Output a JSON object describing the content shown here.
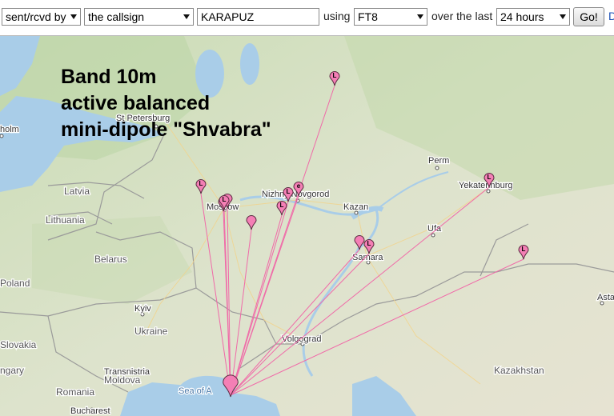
{
  "toolbar": {
    "direction_select": "sent/rcvd by",
    "target_select": "the callsign",
    "callsign_value": "KARAPUZ",
    "using_label": "using",
    "mode_select": "FT8",
    "over_label": "over the last",
    "period_select": "24 hours",
    "go_button": "Go!",
    "edge_link": "D"
  },
  "overlay": {
    "line1": "Band 10m",
    "line2": "active balanced",
    "line3": "mini-dipole \"Shvabra\""
  },
  "map": {
    "colors": {
      "land": "#e4e6d6",
      "land_green": "#c8dcb0",
      "forest": "#b7d3a0",
      "water": "#a9cde8",
      "border": "#9a9a9a",
      "path": "#f06aa8",
      "marker": "#f47fb5",
      "marker_stroke": "#5a2a40"
    },
    "place_labels": {
      "helsinki": "holm",
      "st_petersburg": "St Petersburg",
      "latvia": "Latvia",
      "lithuania": "Lithuania",
      "belarus": "Belarus",
      "poland": "Poland",
      "moscow": "Moscow",
      "nizhny": "Nizhny Novgorod",
      "kazan": "Kazan",
      "perm": "Perm",
      "yekaterinburg": "Yekaterinburg",
      "ufa": "Ufa",
      "samara": "Samara",
      "kyiv": "Kyiv",
      "ukraine": "Ukraine",
      "volgograd": "Volgograd",
      "kazakhstan": "Kazakhstan",
      "slovakia": "Slovakia",
      "hungary": "ngary",
      "transnistria": "Transnistria",
      "moldova": "Moldova",
      "romania": "Romania",
      "bucharest": "Bucharest",
      "sea_of_azov": "Sea of A",
      "asta": "Asta"
    },
    "home_marker": {
      "id": "home"
    },
    "markers": [
      {
        "id": "m1",
        "glyph": "L"
      },
      {
        "id": "m2",
        "glyph": "L"
      },
      {
        "id": "m3",
        "glyph": "L"
      },
      {
        "id": "m4",
        "glyph": "L"
      },
      {
        "id": "m5",
        "glyph": "e"
      },
      {
        "id": "m6",
        "glyph": ""
      },
      {
        "id": "m7",
        "glyph": "L"
      },
      {
        "id": "m8",
        "glyph": "L"
      },
      {
        "id": "m9",
        "glyph": "e"
      },
      {
        "id": "m10",
        "glyph": ""
      },
      {
        "id": "m11",
        "glyph": ""
      },
      {
        "id": "m12",
        "glyph": "L"
      },
      {
        "id": "m13",
        "glyph": "L"
      }
    ]
  }
}
